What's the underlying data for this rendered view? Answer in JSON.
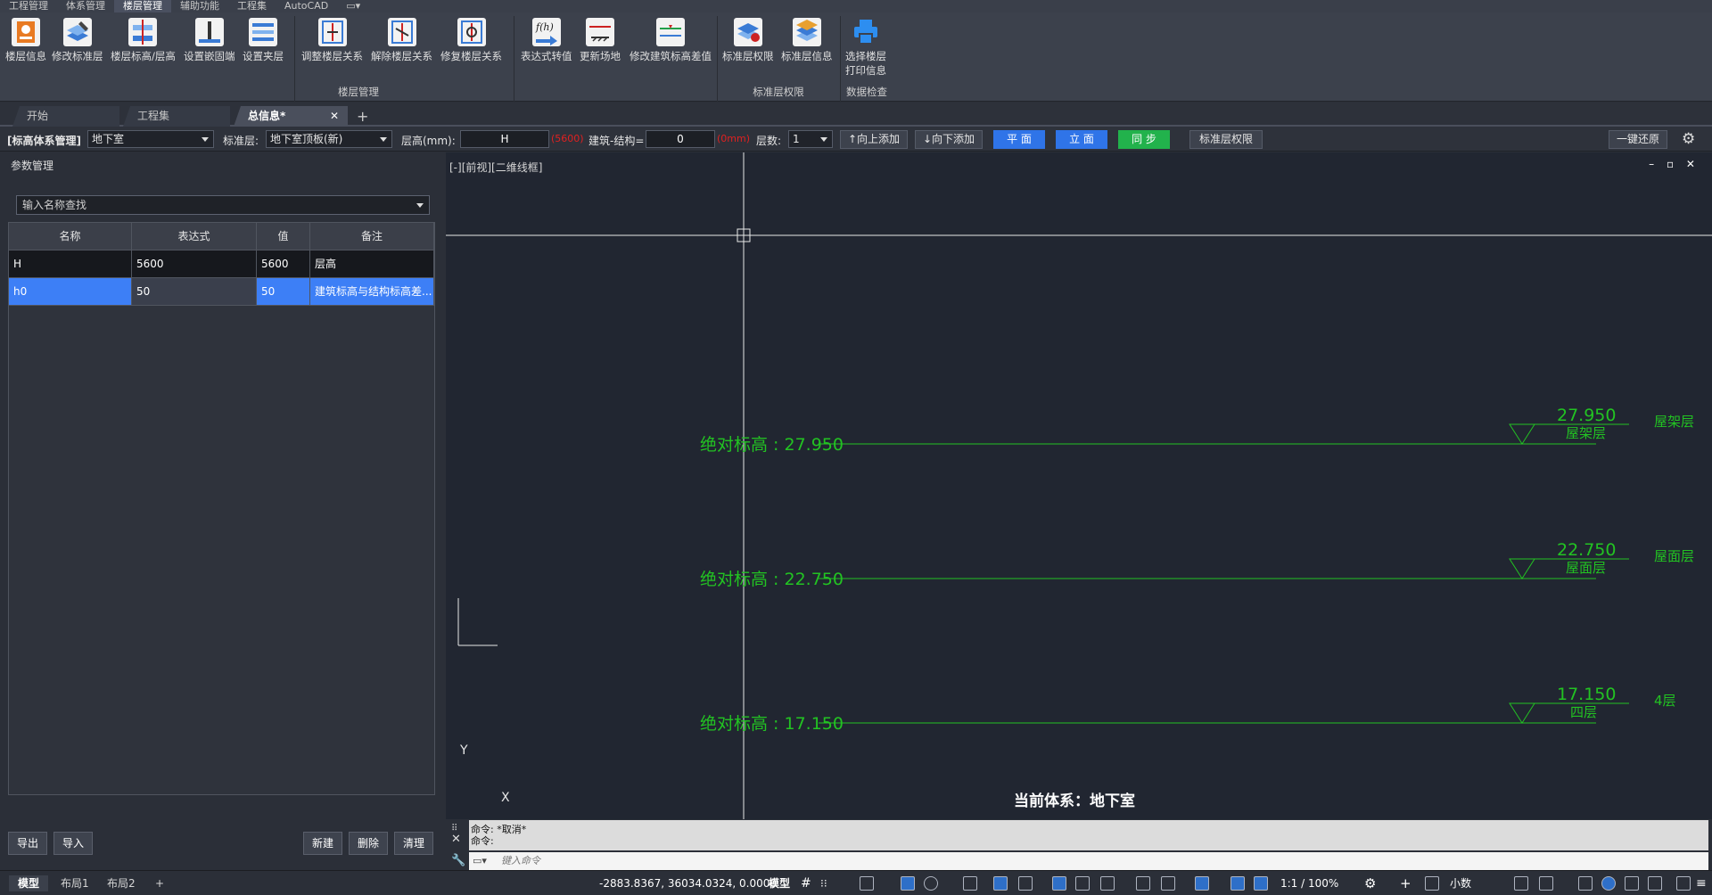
{
  "menu": {
    "tabs": [
      "工程管理",
      "体系管理",
      "楼层管理",
      "辅助功能",
      "工程集",
      "AutoCAD"
    ],
    "active": "楼层管理"
  },
  "ribbon": {
    "buttons": [
      {
        "label": "楼层信息",
        "icon": "floor-info-icon"
      },
      {
        "label": "修改标准层",
        "icon": "edit-standard-floor-icon"
      },
      {
        "label": "楼层标高/层高",
        "icon": "floor-elevation-icon"
      },
      {
        "label": "设置嵌固端",
        "icon": "embed-end-icon"
      },
      {
        "label": "设置夹层",
        "icon": "mezzanine-icon"
      },
      {
        "label": "调整楼层关系",
        "icon": "adjust-relation-icon"
      },
      {
        "label": "解除楼层关系",
        "icon": "release-relation-icon"
      },
      {
        "label": "修复楼层关系",
        "icon": "repair-relation-icon"
      },
      {
        "label": "表达式转值",
        "icon": "formula-icon"
      },
      {
        "label": "更新场地",
        "icon": "update-site-icon"
      },
      {
        "label": "修改建筑标高差值",
        "icon": "elevation-diff-icon"
      },
      {
        "label": "标准层权限",
        "icon": "standard-permission-icon"
      },
      {
        "label": "标准层信息",
        "icon": "standard-info-icon"
      },
      {
        "label": "选择楼层",
        "label2": "打印信息",
        "icon": "printer-icon"
      }
    ],
    "groups": [
      "楼层管理",
      "标准层权限",
      "数据检查"
    ]
  },
  "doc_tabs": {
    "start": "开始",
    "project": "工程集",
    "general": "总信息*",
    "close": "✕",
    "add": "+"
  },
  "toolbar": {
    "system_label": "[标高体系管理]",
    "system_value": "地下室",
    "std_floor_label": "标准层:",
    "std_floor_value": "地下室顶板(新)",
    "height_label": "层高(mm):",
    "height_value": "H",
    "height_hint": "(5600)",
    "diff_label": "建筑-结构=",
    "diff_value": "0",
    "diff_hint": "(0mm)",
    "count_label": "层数:",
    "count_value": "1",
    "add_up": "↑向上添加",
    "add_down": "↓向下添加",
    "plan": "平 面",
    "elevation": "立 面",
    "sync": "同 步",
    "std_permission": "标准层权限",
    "restore": "一键还原"
  },
  "params": {
    "title": "参数管理",
    "search_placeholder": "输入名称查找",
    "headers": [
      "名称",
      "表达式",
      "值",
      "备注"
    ],
    "rows": [
      [
        "H",
        "5600",
        "5600",
        "层高"
      ],
      [
        "h0",
        "50",
        "50",
        "建筑标高与结构标高差..."
      ]
    ],
    "buttons": {
      "export": "导出",
      "import": "导入",
      "new": "新建",
      "delete": "删除",
      "clear": "清理"
    }
  },
  "viewport": {
    "label": "[-][前视][二维线框]",
    "controls": "– ▫ ✕",
    "current_system": "当前体系：地下室",
    "axis_y": "Y",
    "axis_x": "X",
    "levels": [
      {
        "abs_label": "绝对标高 : 27.950",
        "elev": "27.950",
        "name_under": "屋架层",
        "name_right": "屋架层"
      },
      {
        "abs_label": "绝对标高 : 22.750",
        "elev": "22.750",
        "name_under": "屋面层",
        "name_right": "屋面层"
      },
      {
        "abs_label": "绝对标高 : 17.150",
        "elev": "17.150",
        "name_under": "四层",
        "name_right": "4层"
      }
    ],
    "line_color": "#22c322"
  },
  "command": {
    "line1": "命令: *取消*",
    "line2": "命令:",
    "placeholder": "键入命令"
  },
  "status": {
    "layouts": [
      "模型",
      "布局1",
      "布局2"
    ],
    "add": "+",
    "coords": "-2883.8367, 36034.0324, 0.0000",
    "mode": "模型",
    "scale": "1:1 / 100%",
    "units": "小数"
  }
}
